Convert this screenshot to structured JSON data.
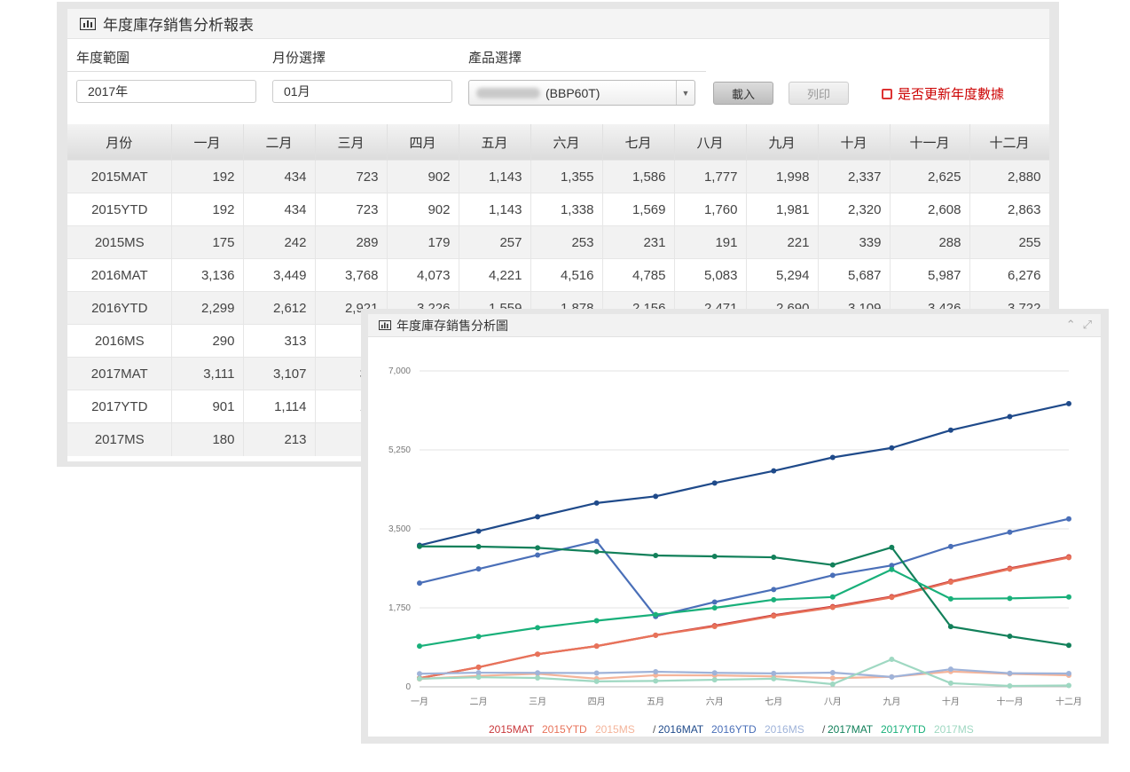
{
  "report": {
    "title": "年度庫存銷售分析報表",
    "filters": {
      "year_label": "年度範圍",
      "month_label": "月份選擇",
      "product_label": "產品選擇",
      "year_value": "2017年",
      "month_value": "01月",
      "product_value": "(BBP60T)"
    },
    "buttons": {
      "load": "載入",
      "print": "列印"
    },
    "update_checkbox_label": "是否更新年度數據",
    "table": {
      "header_first": "月份",
      "months": [
        "一月",
        "二月",
        "三月",
        "四月",
        "五月",
        "六月",
        "七月",
        "八月",
        "九月",
        "十月",
        "十一月",
        "十二月"
      ],
      "rows": [
        {
          "label": "2015MAT",
          "values": [
            "192",
            "434",
            "723",
            "902",
            "1,143",
            "1,355",
            "1,586",
            "1,777",
            "1,998",
            "2,337",
            "2,625",
            "2,880"
          ]
        },
        {
          "label": "2015YTD",
          "values": [
            "192",
            "434",
            "723",
            "902",
            "1,143",
            "1,338",
            "1,569",
            "1,760",
            "1,981",
            "2,320",
            "2,608",
            "2,863"
          ]
        },
        {
          "label": "2015MS",
          "values": [
            "175",
            "242",
            "289",
            "179",
            "257",
            "253",
            "231",
            "191",
            "221",
            "339",
            "288",
            "255"
          ]
        },
        {
          "label": "2016MAT",
          "values": [
            "3,136",
            "3,449",
            "3,768",
            "4,073",
            "4,221",
            "4,516",
            "4,785",
            "5,083",
            "5,294",
            "5,687",
            "5,987",
            "6,276"
          ]
        },
        {
          "label": "2016YTD",
          "values": [
            "2,299",
            "2,612",
            "2,921",
            "3,226",
            "1,559",
            "1,878",
            "2,156",
            "2,471",
            "2,690",
            "3,109",
            "3,426",
            "3,722"
          ]
        },
        {
          "label": "2016MS",
          "values": [
            "290",
            "313",
            "3"
          ]
        },
        {
          "label": "2017MAT",
          "values": [
            "3,111",
            "3,107",
            "3,0"
          ]
        },
        {
          "label": "2017YTD",
          "values": [
            "901",
            "1,114",
            "1,3"
          ]
        },
        {
          "label": "2017MS",
          "values": [
            "180",
            "213",
            "1"
          ]
        }
      ]
    }
  },
  "chart_panel": {
    "title": "年度庫存銷售分析圖",
    "tool_icons": [
      "chevron-up-icon",
      "expand-icon"
    ]
  },
  "chart_data": {
    "type": "line",
    "x": [
      "一月",
      "二月",
      "三月",
      "四月",
      "五月",
      "六月",
      "七月",
      "八月",
      "九月",
      "十月",
      "十一月",
      "十二月"
    ],
    "ylim": [
      0,
      7000
    ],
    "yticks": [
      "0",
      "1,750",
      "3,500",
      "5,250",
      "7,000"
    ],
    "grid": true,
    "legend_position": "bottom",
    "series": [
      {
        "name": "2015MAT",
        "color": "#c8373a",
        "values": [
          192,
          434,
          723,
          902,
          1143,
          1355,
          1586,
          1777,
          1998,
          2337,
          2625,
          2880
        ]
      },
      {
        "name": "2015YTD",
        "color": "#e8735a",
        "values": [
          192,
          434,
          723,
          902,
          1143,
          1338,
          1569,
          1760,
          1981,
          2320,
          2608,
          2863
        ]
      },
      {
        "name": "2015MS",
        "color": "#f4b49a",
        "values": [
          175,
          242,
          289,
          179,
          257,
          253,
          231,
          191,
          221,
          339,
          288,
          255
        ]
      },
      {
        "name": "2016MAT",
        "color": "#1f4a8a",
        "values": [
          3136,
          3449,
          3768,
          4073,
          4221,
          4516,
          4785,
          5083,
          5294,
          5687,
          5987,
          6276
        ]
      },
      {
        "name": "2016YTD",
        "color": "#4a6fb8",
        "values": [
          2299,
          2612,
          2921,
          3226,
          1559,
          1878,
          2156,
          2471,
          2690,
          3109,
          3426,
          3722
        ]
      },
      {
        "name": "2016MS",
        "color": "#9fb3d9",
        "values": [
          290,
          313,
          309,
          305,
          335,
          310,
          297,
          315,
          219,
          390,
          300,
          295
        ]
      },
      {
        "name": "2017MAT",
        "color": "#12805a",
        "values": [
          3111,
          3107,
          3080,
          2995,
          2910,
          2890,
          2870,
          2700,
          3090,
          1335,
          1120,
          920
        ]
      },
      {
        "name": "2017YTD",
        "color": "#19b07a",
        "values": [
          901,
          1114,
          1310,
          1465,
          1600,
          1750,
          1930,
          1990,
          2600,
          1950,
          1960,
          1990
        ]
      },
      {
        "name": "2017MS",
        "color": "#9fd8c2",
        "values": [
          180,
          213,
          196,
          120,
          131,
          156,
          180,
          59,
          610,
          80,
          20,
          30
        ]
      }
    ],
    "legend_separator": "/"
  }
}
